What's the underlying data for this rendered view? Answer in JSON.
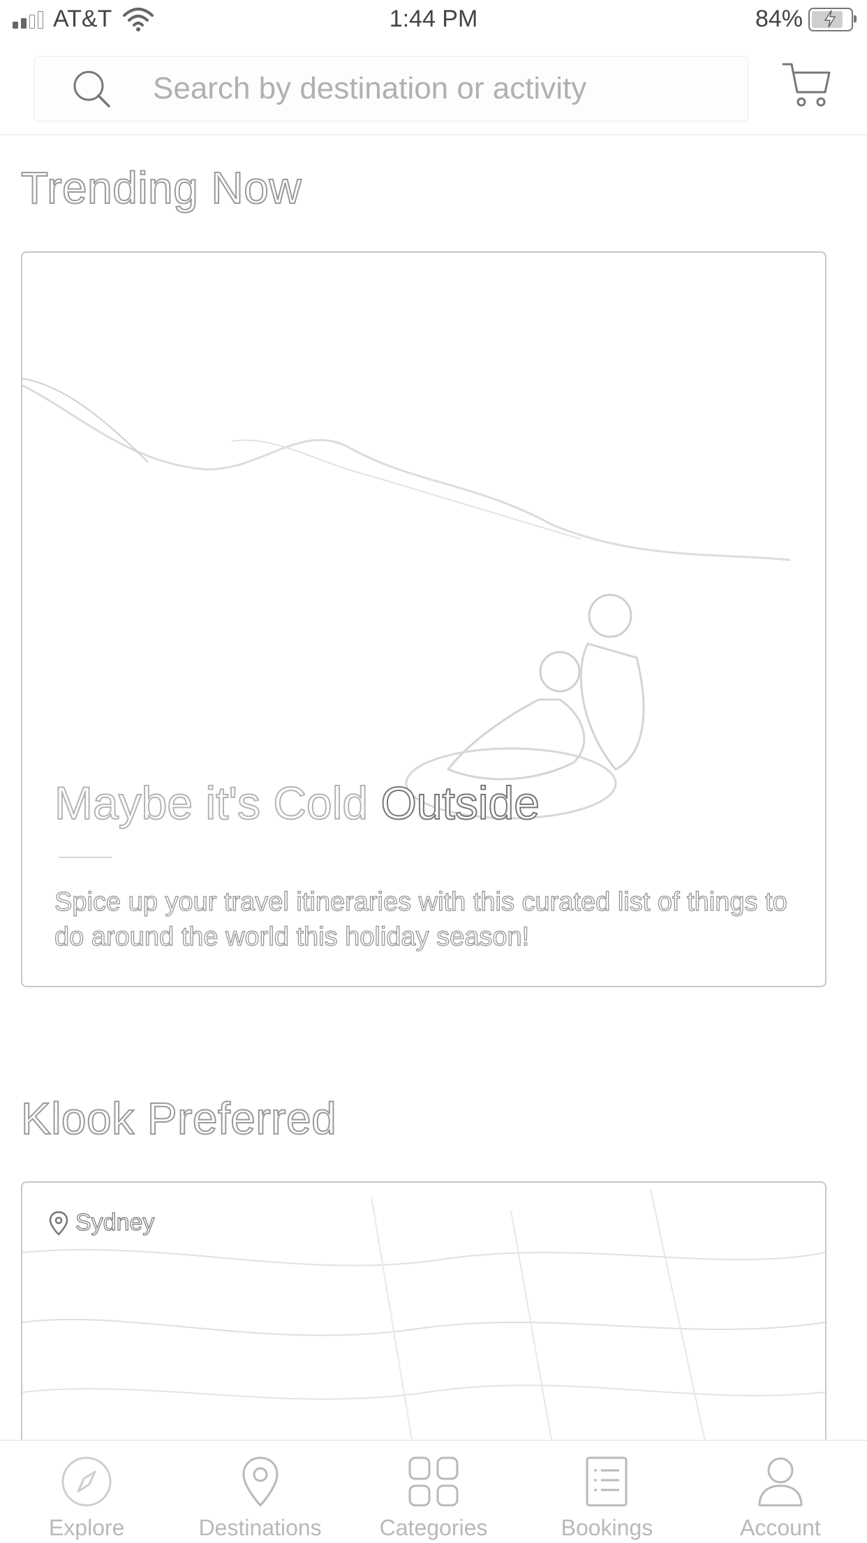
{
  "status_bar": {
    "carrier": "AT&T",
    "time": "1:44 PM",
    "battery_percent": "84%",
    "battery_level": 0.84,
    "signal_bars_active": 2,
    "signal_bars_total": 4
  },
  "search": {
    "placeholder": "Search by destination or activity",
    "value": ""
  },
  "sections": {
    "trending": {
      "title": "Trending Now",
      "card": {
        "title_part1": "Maybe it's Cold ",
        "title_part2": "Outside",
        "description": "Spice up your travel itineraries with this curated list of things to do around the world this holiday season!"
      }
    },
    "preferred": {
      "title": "Klook Preferred",
      "card": {
        "location": "Sydney"
      }
    }
  },
  "tab_bar": {
    "tabs": [
      {
        "label": "Explore",
        "icon": "compass-icon"
      },
      {
        "label": "Destinations",
        "icon": "map-pin-icon"
      },
      {
        "label": "Categories",
        "icon": "grid-icon"
      },
      {
        "label": "Bookings",
        "icon": "list-icon"
      },
      {
        "label": "Account",
        "icon": "person-icon"
      }
    ]
  },
  "colors": {
    "text_outline": "#9a9a9a",
    "tab_inactive": "#b9b9b9",
    "border": "#c8c8c8"
  }
}
